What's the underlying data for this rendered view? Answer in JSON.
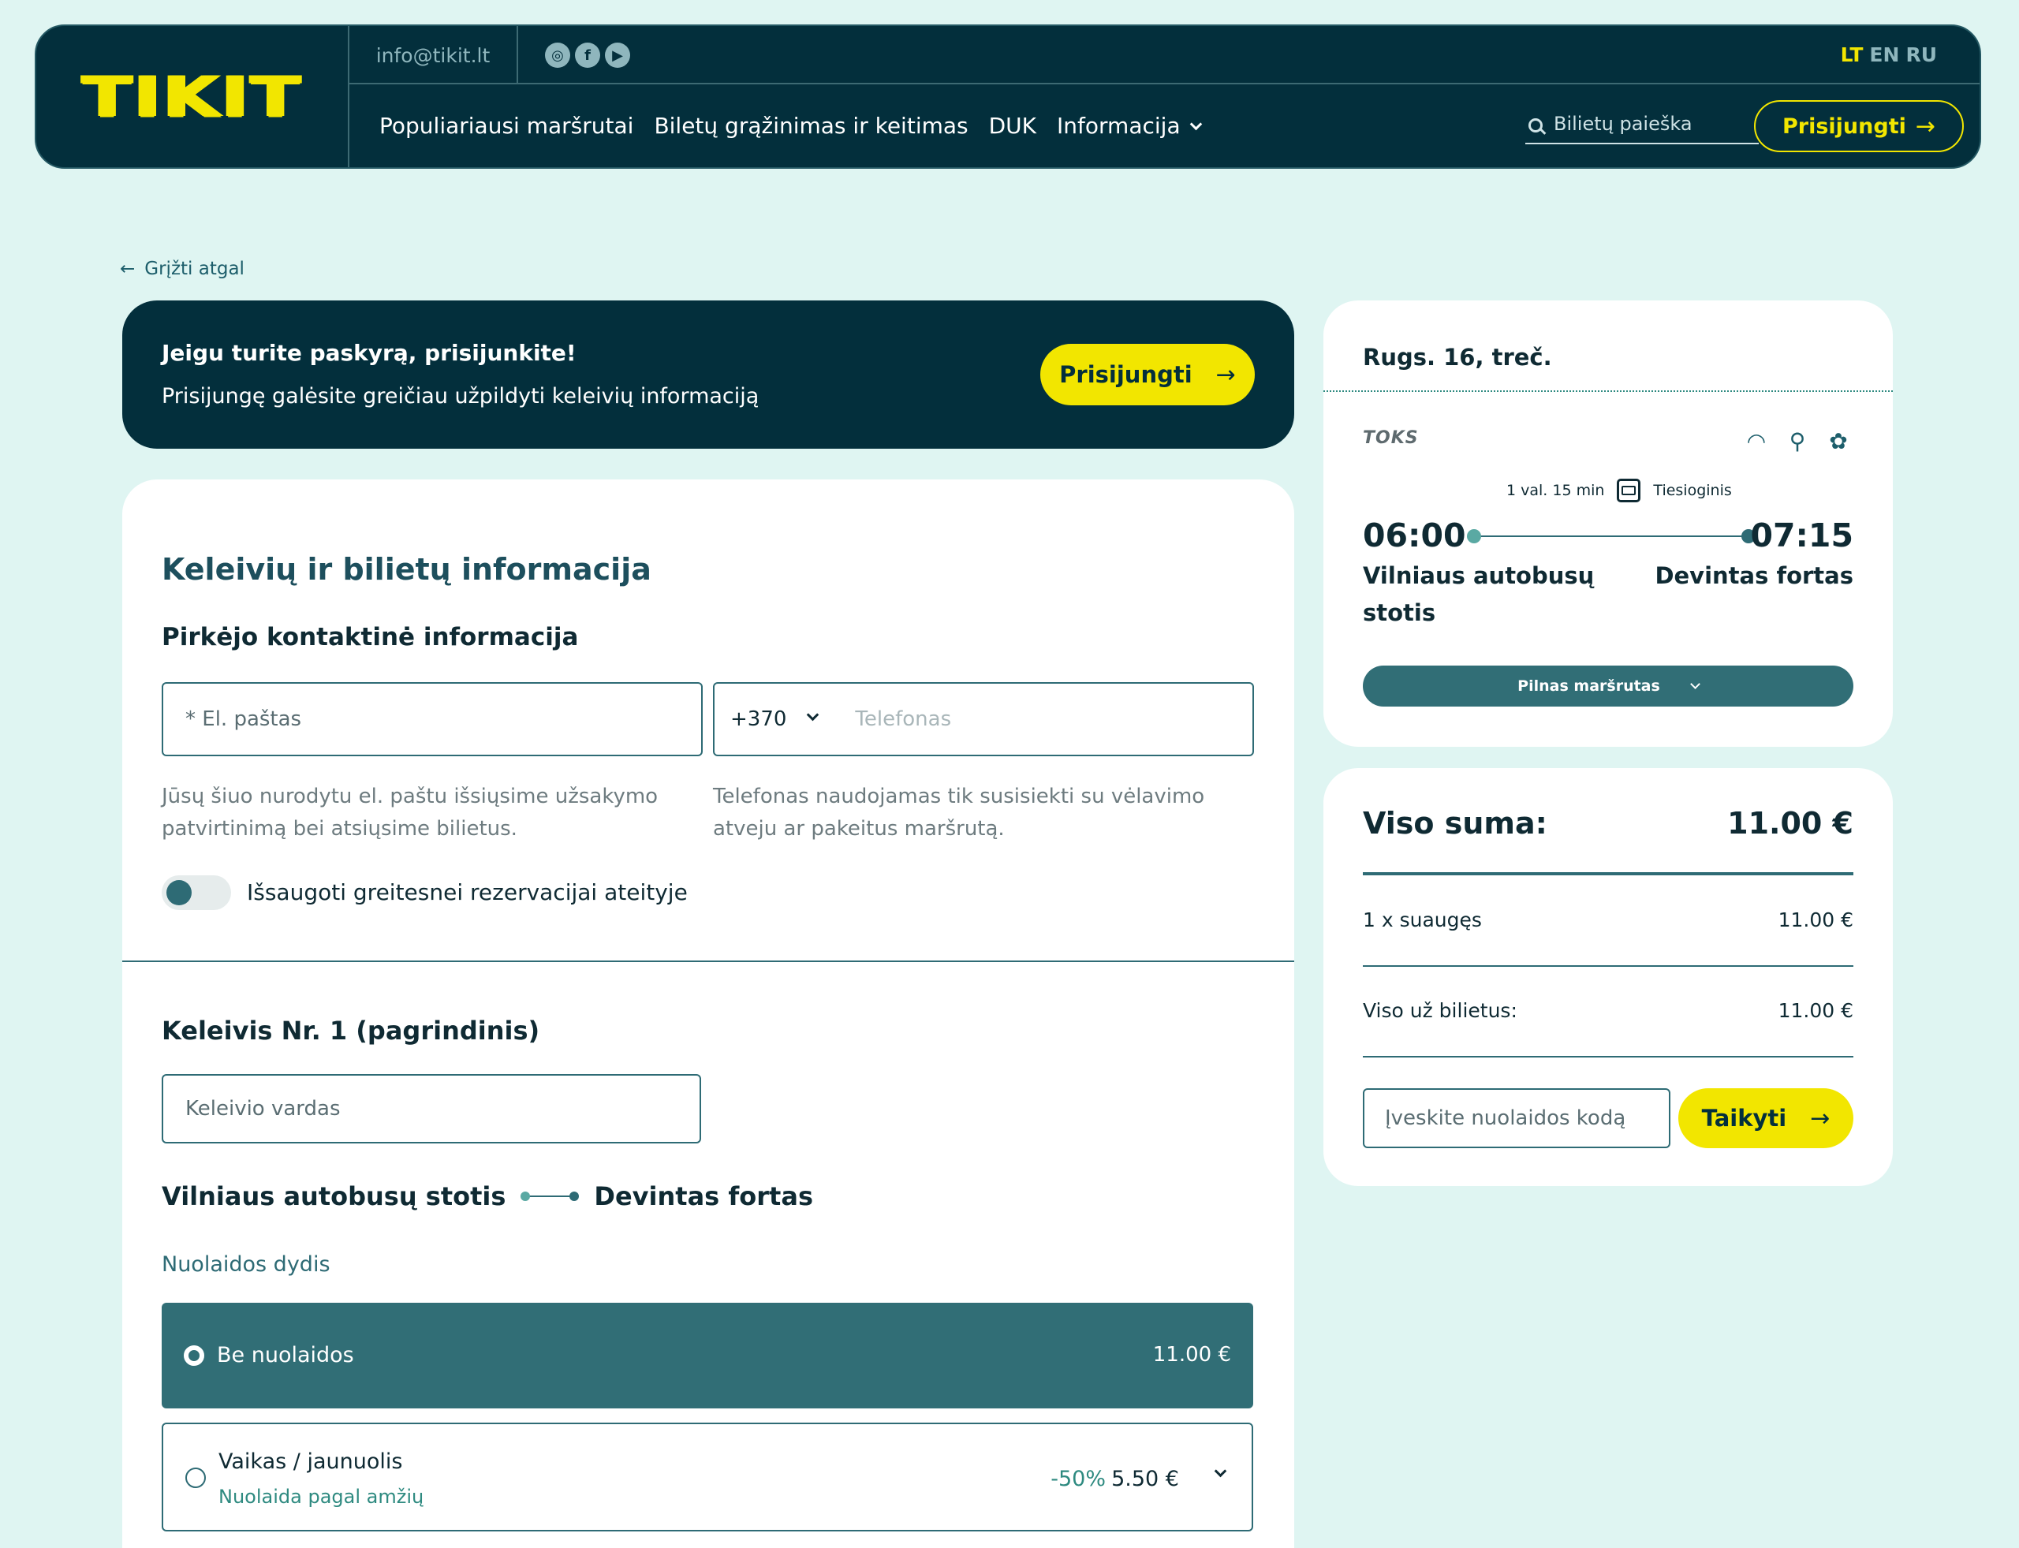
{
  "header": {
    "logo": "TIKIT",
    "email": "info@tikit.lt",
    "socials": [
      "instagram-icon",
      "facebook-icon",
      "youtube-icon"
    ],
    "languages": [
      "LT",
      "EN",
      "RU"
    ],
    "active_language": "LT",
    "nav": [
      "Populiariausi maršrutai",
      "Biletų grąžinimas ir keitimas",
      "DUK",
      "Informacija"
    ],
    "search_placeholder": "Bilietų paieška",
    "login_label": "Prisijungti"
  },
  "back_label": "Grįžti atgal",
  "banner": {
    "title": "Jeigu turite paskyrą, prisijunkite!",
    "subtitle": "Prisijungę galėsite greičiau užpildyti keleivių informaciją",
    "button": "Prisijungti"
  },
  "form": {
    "title": "Keleivių ir bilietų informacija",
    "contact_title": "Pirkėjo kontaktinė informacija",
    "email_placeholder": "* El. paštas",
    "phone_code": "+370",
    "phone_placeholder": "Telefonas",
    "email_hint": "Jūsų šiuo nurodytu el. paštu išsiųsime užsakymo patvirtinimą bei atsiųsime bilietus.",
    "phone_hint": "Telefonas naudojamas tik susisiekti su vėlavimo atveju ar pakeitus maršrutą.",
    "save_toggle": "Išsaugoti greitesnei rezervacijai ateityje",
    "passenger_title": "Keleivis Nr. 1 (pagrindinis)",
    "passenger_name_placeholder": "Keleivio vardas",
    "route_from": "Vilniaus autobusų stotis",
    "route_to": "Devintas fortas",
    "discount_label": "Nuolaidos dydis",
    "options": [
      {
        "name": "Be nuolaidos",
        "price": "11.00 €",
        "selected": true
      },
      {
        "name": "Vaikas / jaunuolis",
        "subtitle": "Nuolaida pagal amžių",
        "percent": "-50%",
        "price": "5.50 €",
        "selected": false
      }
    ]
  },
  "trip": {
    "date": "Rugs. 16, treč.",
    "carrier": "TOKS",
    "amenities": [
      "wifi-icon",
      "bicycle-icon",
      "paw-icon"
    ],
    "duration": "1 val. 15 min",
    "type": "Tiesioginis",
    "departure_time": "06:00",
    "arrival_time": "07:15",
    "departure_station": "Vilniaus autobusų stotis",
    "arrival_station": "Devintas fortas",
    "full_route_label": "Pilnas maršrutas"
  },
  "summary": {
    "title": "Viso suma:",
    "total": "11.00 €",
    "line_label": "1 x suaugęs",
    "line_value": "11.00 €",
    "tickets_label": "Viso už bilietus:",
    "tickets_value": "11.00 €",
    "promo_placeholder": "Įveskite nuolaidos kodą",
    "apply_label": "Taikyti"
  },
  "colors": {
    "background": "#dff5f2",
    "navy": "#032f3c",
    "accent_yellow": "#f2e600",
    "teal": "#316e76"
  }
}
